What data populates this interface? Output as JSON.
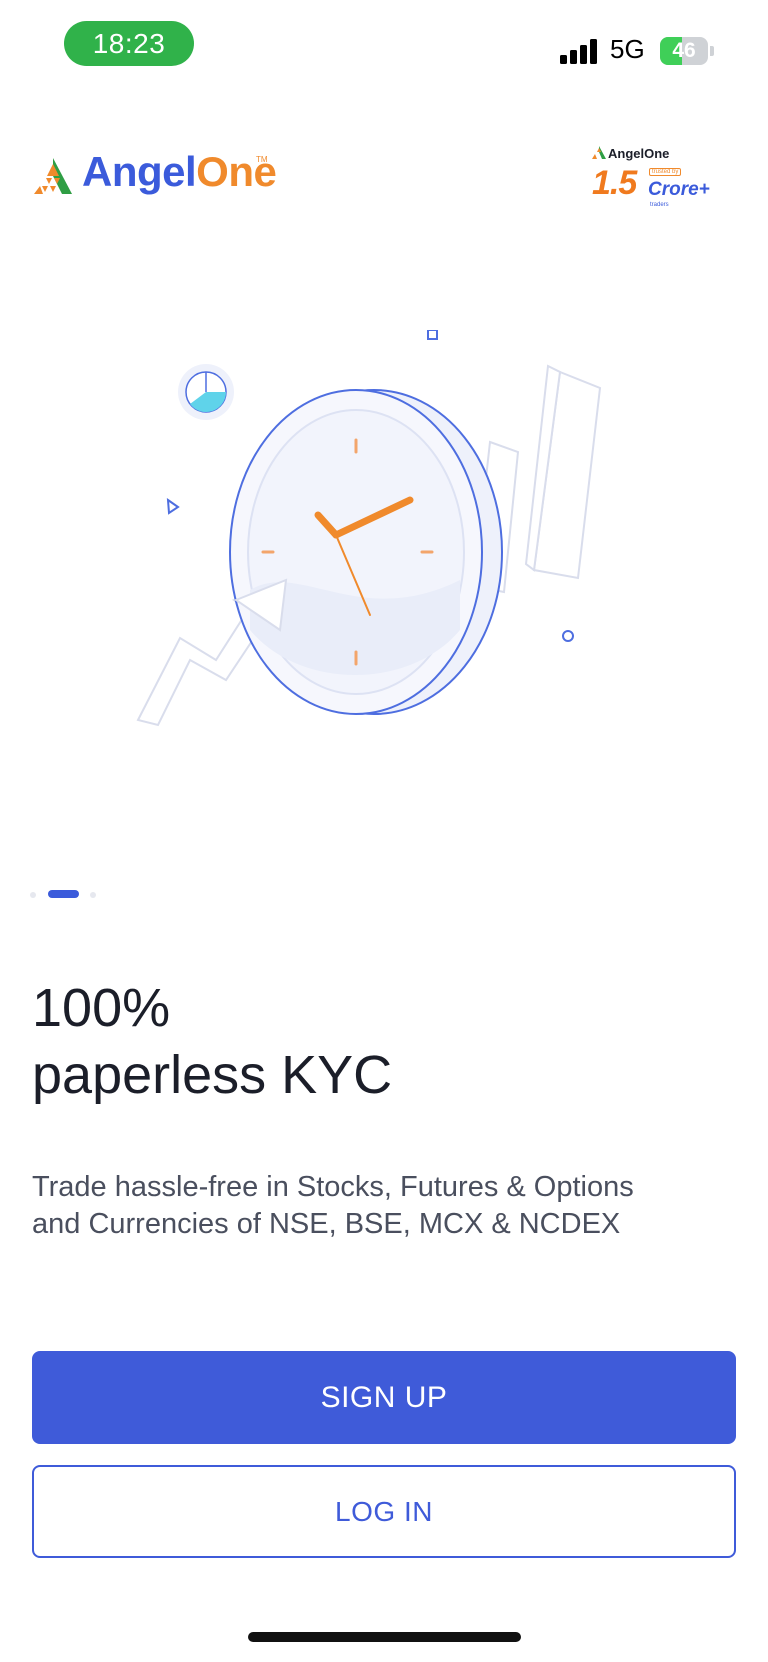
{
  "status_bar": {
    "time": "18:23",
    "network": "5G",
    "battery_percent": "46",
    "battery_level": 0.46,
    "time_pill_color": "#30b24a"
  },
  "header": {
    "brand_part1": "Angel",
    "brand_part2": "One",
    "trademark": "TM",
    "badge": {
      "brand_part1": "AngelOne",
      "figure": "1.5",
      "word": "Crore+",
      "mini_label": "trusted by",
      "sub_label": "traders"
    }
  },
  "carousel": {
    "slide_count": 3,
    "active_index": 1
  },
  "content": {
    "headline_line1": "100%",
    "headline_line2": "paperless KYC",
    "subtext_line1": "Trade hassle-free in Stocks, Futures & Options",
    "subtext_line2": "and Currencies of NSE, BSE, MCX & NCDEX"
  },
  "actions": {
    "signup_label": "SIGN UP",
    "login_label": "LOG IN"
  },
  "colors": {
    "primary": "#3f5bd9",
    "brand_orange": "#f08a2c",
    "text_dark": "#1b1e29",
    "text_secondary": "#4a4f5e"
  },
  "icons": {
    "hero": "clock-chart-illustration",
    "signal": "cellular-signal-icon",
    "battery": "battery-charging-icon"
  }
}
